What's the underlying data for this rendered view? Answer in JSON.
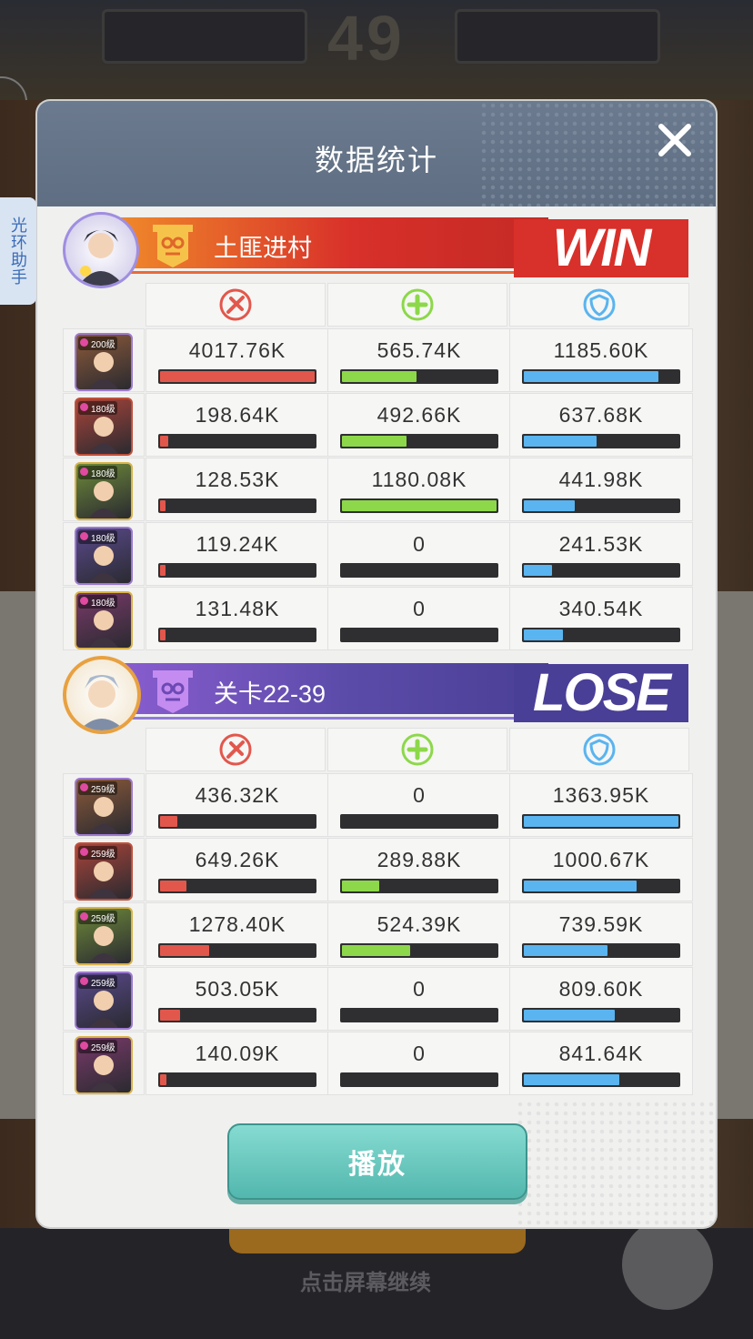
{
  "background": {
    "round_number": "49",
    "bottom_hint": "点击屏幕继续"
  },
  "helper_tab": {
    "label": "光环助手"
  },
  "dialog": {
    "title": "数据统计",
    "play_label": "播放"
  },
  "colors": {
    "damage": "#e2574c",
    "heal": "#8dd84a",
    "shield": "#5ab4ef",
    "win_red": "#d8302a",
    "lose_purple": "#4a3f96"
  },
  "columns": [
    "damage-icon",
    "heal-icon",
    "shield-icon"
  ],
  "team_win": {
    "name": "土匪进村",
    "result": "WIN",
    "heroes": [
      {
        "level": "200级",
        "damage": "4017.76K",
        "heal": "565.74K",
        "shield": "1185.60K",
        "damage_pct": 1.0,
        "heal_pct": 0.48,
        "shield_pct": 0.87
      },
      {
        "level": "180级",
        "damage": "198.64K",
        "heal": "492.66K",
        "shield": "637.68K",
        "damage_pct": 0.05,
        "heal_pct": 0.42,
        "shield_pct": 0.47
      },
      {
        "level": "180级",
        "damage": "128.53K",
        "heal": "1180.08K",
        "shield": "441.98K",
        "damage_pct": 0.03,
        "heal_pct": 1.0,
        "shield_pct": 0.33
      },
      {
        "level": "180级",
        "damage": "119.24K",
        "heal": "0",
        "shield": "241.53K",
        "damage_pct": 0.03,
        "heal_pct": 0.0,
        "shield_pct": 0.18
      },
      {
        "level": "180级",
        "damage": "131.48K",
        "heal": "0",
        "shield": "340.54K",
        "damage_pct": 0.03,
        "heal_pct": 0.0,
        "shield_pct": 0.25
      }
    ]
  },
  "team_lose": {
    "name": "关卡22-39",
    "result": "LOSE",
    "heroes": [
      {
        "level": "259级",
        "damage": "436.32K",
        "heal": "0",
        "shield": "1363.95K",
        "damage_pct": 0.11,
        "heal_pct": 0.0,
        "shield_pct": 1.0
      },
      {
        "level": "259级",
        "damage": "649.26K",
        "heal": "289.88K",
        "shield": "1000.67K",
        "damage_pct": 0.17,
        "heal_pct": 0.24,
        "shield_pct": 0.73
      },
      {
        "level": "259级",
        "damage": "1278.40K",
        "heal": "524.39K",
        "shield": "739.59K",
        "damage_pct": 0.32,
        "heal_pct": 0.44,
        "shield_pct": 0.54
      },
      {
        "level": "259级",
        "damage": "503.05K",
        "heal": "0",
        "shield": "809.60K",
        "damage_pct": 0.13,
        "heal_pct": 0.0,
        "shield_pct": 0.59
      },
      {
        "level": "259级",
        "damage": "140.09K",
        "heal": "0",
        "shield": "841.64K",
        "damage_pct": 0.04,
        "heal_pct": 0.0,
        "shield_pct": 0.62
      }
    ]
  }
}
